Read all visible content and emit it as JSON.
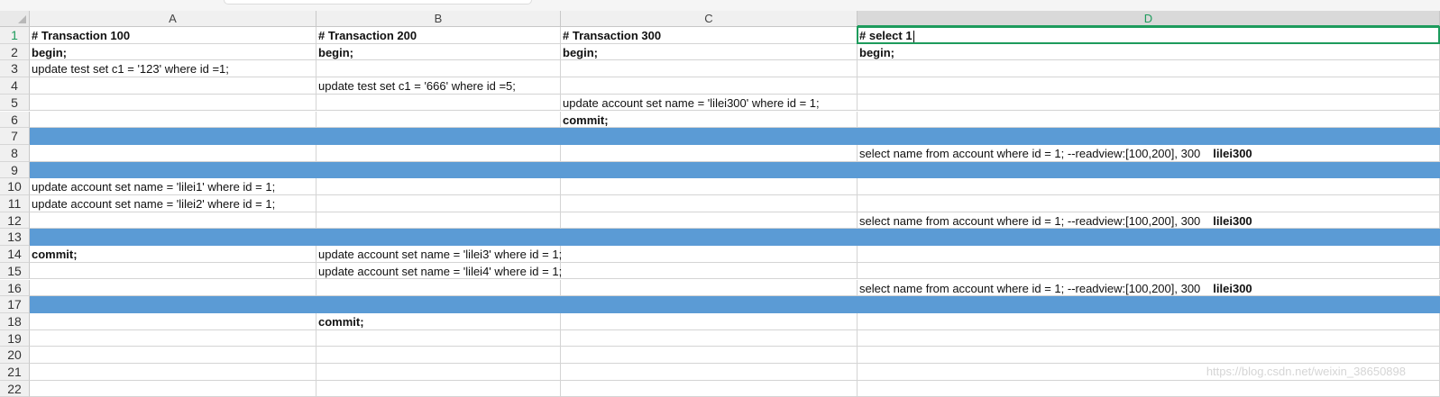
{
  "columns": [
    "A",
    "B",
    "C",
    "D"
  ],
  "active_column": "D",
  "rows": [
    {
      "n": "1",
      "A": "# Transaction 100",
      "B": "# Transaction 200",
      "C": "# Transaction 300",
      "D": "# select 1",
      "bold": true
    },
    {
      "n": "2",
      "A": "begin;",
      "B": "begin;",
      "C": "begin;",
      "D": "begin;",
      "bold": true
    },
    {
      "n": "3",
      "A": "update test set c1 = '123' where id =1;",
      "B": "",
      "C": "",
      "D": ""
    },
    {
      "n": "4",
      "A": "",
      "B": "update test set c1 = '666' where id =5;",
      "C": "",
      "D": ""
    },
    {
      "n": "5",
      "A": "",
      "B": "",
      "C": "update account set name = 'lilei300' where id = 1;",
      "D": ""
    },
    {
      "n": "6",
      "A": "",
      "B": "",
      "C": "commit;",
      "D": "",
      "boldC": true
    },
    {
      "n": "7",
      "fill": true
    },
    {
      "n": "8",
      "A": "",
      "B": "",
      "C": "",
      "D": "select name from account where id = 1;   --readview:[100,200], 300",
      "D_bold": "lilei300"
    },
    {
      "n": "9",
      "fill": true
    },
    {
      "n": "10",
      "A": "update account set name = 'lilei1' where id = 1;",
      "B": "",
      "C": "",
      "D": ""
    },
    {
      "n": "11",
      "A": "update account set name = 'lilei2' where id = 1;",
      "B": "",
      "C": "",
      "D": ""
    },
    {
      "n": "12",
      "A": "",
      "B": "",
      "C": "",
      "D": "select name from account where id = 1;   --readview:[100,200], 300",
      "D_bold": "lilei300"
    },
    {
      "n": "13",
      "fill": true
    },
    {
      "n": "14",
      "A": "commit;",
      "B": "update account set name = 'lilei3' where id = 1;",
      "C": "",
      "D": "",
      "boldA": true
    },
    {
      "n": "15",
      "A": "",
      "B": "update account set name = 'lilei4' where id = 1;",
      "C": "",
      "D": ""
    },
    {
      "n": "16",
      "A": "",
      "B": "",
      "C": "",
      "D": "select name from account where id = 1;   --readview:[100,200], 300",
      "D_bold": "lilei300"
    },
    {
      "n": "17",
      "fill": true
    },
    {
      "n": "18",
      "A": "",
      "B": "commit;",
      "C": "",
      "D": "",
      "boldB": true
    },
    {
      "n": "19",
      "A": "",
      "B": "",
      "C": "",
      "D": ""
    },
    {
      "n": "20",
      "A": "",
      "B": "",
      "C": "",
      "D": ""
    },
    {
      "n": "21",
      "A": "",
      "B": "",
      "C": "",
      "D": ""
    },
    {
      "n": "22",
      "A": "",
      "B": "",
      "C": "",
      "D": ""
    }
  ],
  "watermark": "https://blog.csdn.net/weixin_38650898",
  "colors": {
    "fill": "#5b9bd5",
    "selection": "#1d9b5c"
  }
}
